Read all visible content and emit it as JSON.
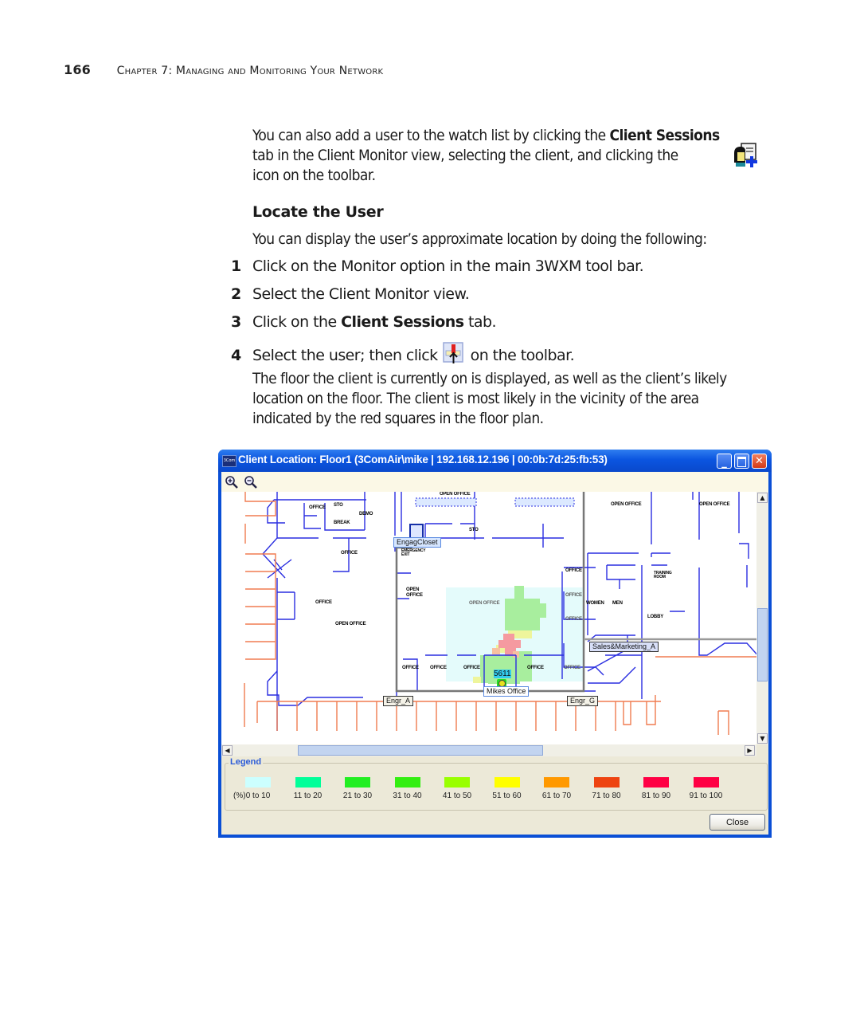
{
  "header": {
    "page_number": "166",
    "chapter": "Chapter 7: Managing and Monitoring Your Network"
  },
  "intro": {
    "line1_pre": "You can also add a user to the watch list by clicking the ",
    "line1_bold": "Client Sessions",
    "line2": "tab in the Client Monitor view, selecting the client, and clicking the",
    "line3": "icon on the toolbar.",
    "icon": "add-to-watch-list-icon"
  },
  "section": {
    "heading": "Locate the User",
    "lead": "You can display the user’s approximate location by doing the following:",
    "steps": [
      {
        "num": "1",
        "text": "Click on the Monitor option in the main 3WXM tool bar."
      },
      {
        "num": "2",
        "text": "Select the Client Monitor view."
      },
      {
        "num": "3",
        "pre": "Click on the ",
        "bold": "Client Sessions",
        "post": " tab."
      },
      {
        "num": "4",
        "pre": "Select the user; then click ",
        "post": " on the toolbar.",
        "icon": "locate-client-icon"
      }
    ],
    "closing": [
      "The floor the client is currently on is displayed, as well as the client’s likely",
      "location on the floor. The client is most likely in the vicinity of the area",
      "indicated by the red squares in the floor plan."
    ]
  },
  "window": {
    "title": "Client Location: Floor1 (3ComAir\\mike | 192.168.12.196 | 00:0b:7d:25:fb:53)",
    "app_icon": "3Com",
    "toolbar": {
      "zoom_in": "zoom-in-icon",
      "zoom_out": "zoom-out-icon"
    },
    "map": {
      "labels": {
        "eng_closet": "EngagCloset",
        "sales": "Sales&Marketing_A",
        "mikes_office": "Mikes Office",
        "engr_a": "Engr_A",
        "engr_g": "Engr_G",
        "ap_id": "5611"
      },
      "rooms": [
        "OFFICE",
        "STO",
        "DEMO",
        "BREAK",
        "OFFICE",
        "OFFICE",
        "OPEN OFFICE",
        "EMERGENCY EXIT",
        "OPEN OFFICE",
        "OPEN OFFICE",
        "STO",
        "OPEN OFFICE",
        "OPEN OFFICE",
        "OPEN OFFICE",
        "OFFICE",
        "OFFICE",
        "OFFICE",
        "OFFICE",
        "OFFICE",
        "OFFICE",
        "OFFICE",
        "OFFICE",
        "WOMEN",
        "MEN",
        "TRAINING ROOM",
        "LOBBY",
        "OPEN OFFICE"
      ]
    },
    "legend": {
      "title": "Legend",
      "unit": "(%)",
      "items": [
        {
          "label": "0 to 10",
          "color": "#ccffff"
        },
        {
          "label": "11 to 20",
          "color": "#00ff99"
        },
        {
          "label": "21 to 30",
          "color": "#22ee22"
        },
        {
          "label": "31 to 40",
          "color": "#33ee11"
        },
        {
          "label": "41 to 50",
          "color": "#99ff00"
        },
        {
          "label": "51 to 60",
          "color": "#ffff00"
        },
        {
          "label": "61 to 70",
          "color": "#ff9900"
        },
        {
          "label": "71 to 80",
          "color": "#ee4411"
        },
        {
          "label": "81 to 90",
          "color": "#ff0044"
        },
        {
          "label": "91 to 100",
          "color": "#ff0044"
        }
      ]
    },
    "close_label": "Close"
  }
}
